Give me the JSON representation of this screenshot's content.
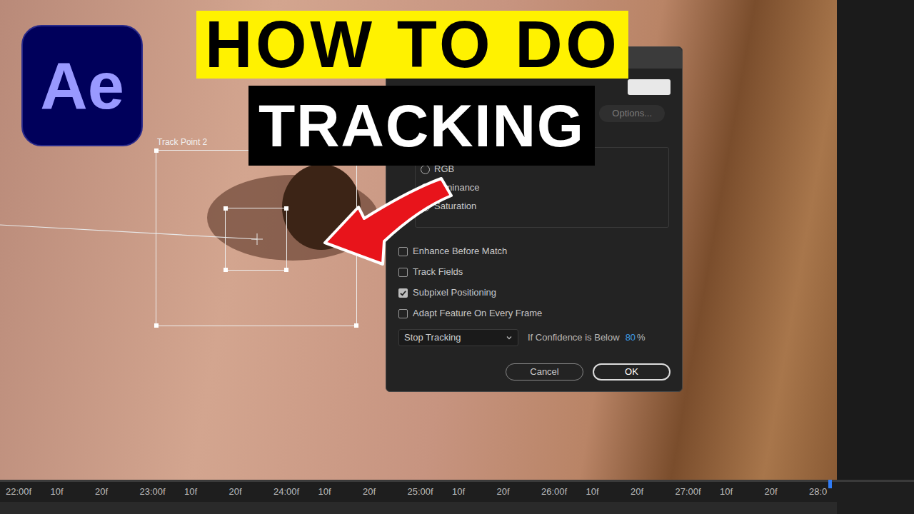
{
  "logo": {
    "text": "Ae"
  },
  "headline": {
    "line1": "HOW TO DO",
    "line2": "TRACKING"
  },
  "track_point": {
    "label": "Track Point 2"
  },
  "dialog": {
    "options_button": "Options...",
    "channels": [
      {
        "label": "RGB",
        "selected": false
      },
      {
        "label": "Luminance",
        "selected": true
      },
      {
        "label": "Saturation",
        "selected": false
      }
    ],
    "checkboxes": [
      {
        "label": "Enhance Before Match",
        "checked": false
      },
      {
        "label": "Track Fields",
        "checked": false
      },
      {
        "label": "Subpixel Positioning",
        "checked": true
      },
      {
        "label": "Adapt Feature On Every Frame",
        "checked": false
      }
    ],
    "failure_action": "Stop Tracking",
    "confidence_label": "If Confidence is Below",
    "confidence_value": "80",
    "confidence_unit": "%",
    "buttons": [
      "Cancel",
      "OK"
    ]
  },
  "timeline": {
    "ticks": [
      "22:00f",
      "10f",
      "20f",
      "23:00f",
      "10f",
      "20f",
      "24:00f",
      "10f",
      "20f",
      "25:00f",
      "10f",
      "20f",
      "26:00f",
      "10f",
      "20f",
      "27:00f",
      "10f",
      "20f",
      "28:0"
    ]
  }
}
